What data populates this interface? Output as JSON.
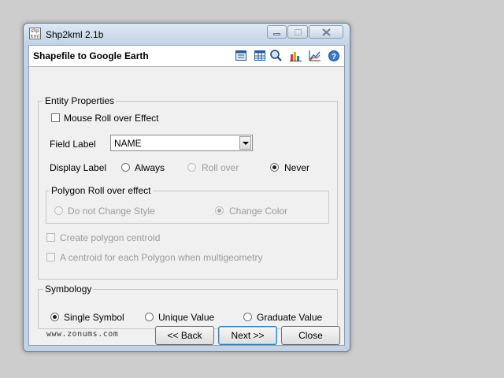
{
  "window": {
    "title": "Shp2kml 2.1b",
    "app_icon_text": "shp kml",
    "header_title": "Shapefile to Google Earth"
  },
  "toolbar_icons": [
    "layer-view-icon",
    "table-view-icon",
    "query-icon",
    "chart-icon",
    "graph-icon",
    "help-icon"
  ],
  "entity_properties": {
    "legend": "Entity Properties",
    "mouse_rollover_label": "Mouse Roll over Effect",
    "mouse_rollover_checked": false,
    "field_label_caption": "Field Label",
    "field_label_value": "NAME",
    "display_label_caption": "Display Label",
    "display_label_options": [
      {
        "label": "Always",
        "selected": false,
        "enabled": true
      },
      {
        "label": "Roll over",
        "selected": false,
        "enabled": false
      },
      {
        "label": "Never",
        "selected": true,
        "enabled": true
      }
    ],
    "polygon_rollover": {
      "legend": "Polygon Roll over effect",
      "options": [
        {
          "label": "Do not Change Style",
          "selected": false,
          "enabled": false
        },
        {
          "label": "Change Color",
          "selected": true,
          "enabled": false
        }
      ]
    },
    "create_centroid_label": "Create polygon centroid",
    "centroid_each_label": "A centroid for each Polygon when multigeometry"
  },
  "symbology": {
    "legend": "Symbology",
    "options": [
      {
        "label": "Single Symbol",
        "selected": true
      },
      {
        "label": "Unique Value",
        "selected": false
      },
      {
        "label": "Graduate Value",
        "selected": false
      }
    ]
  },
  "footer": {
    "brand": "www.zonums.com",
    "back_label": "<< Back",
    "next_label": "Next >>",
    "close_label": "Close"
  },
  "colors": {
    "frame": "#c3d3e6",
    "dialog_bg": "#f0f0f0",
    "accent": "#3c7fb1"
  }
}
